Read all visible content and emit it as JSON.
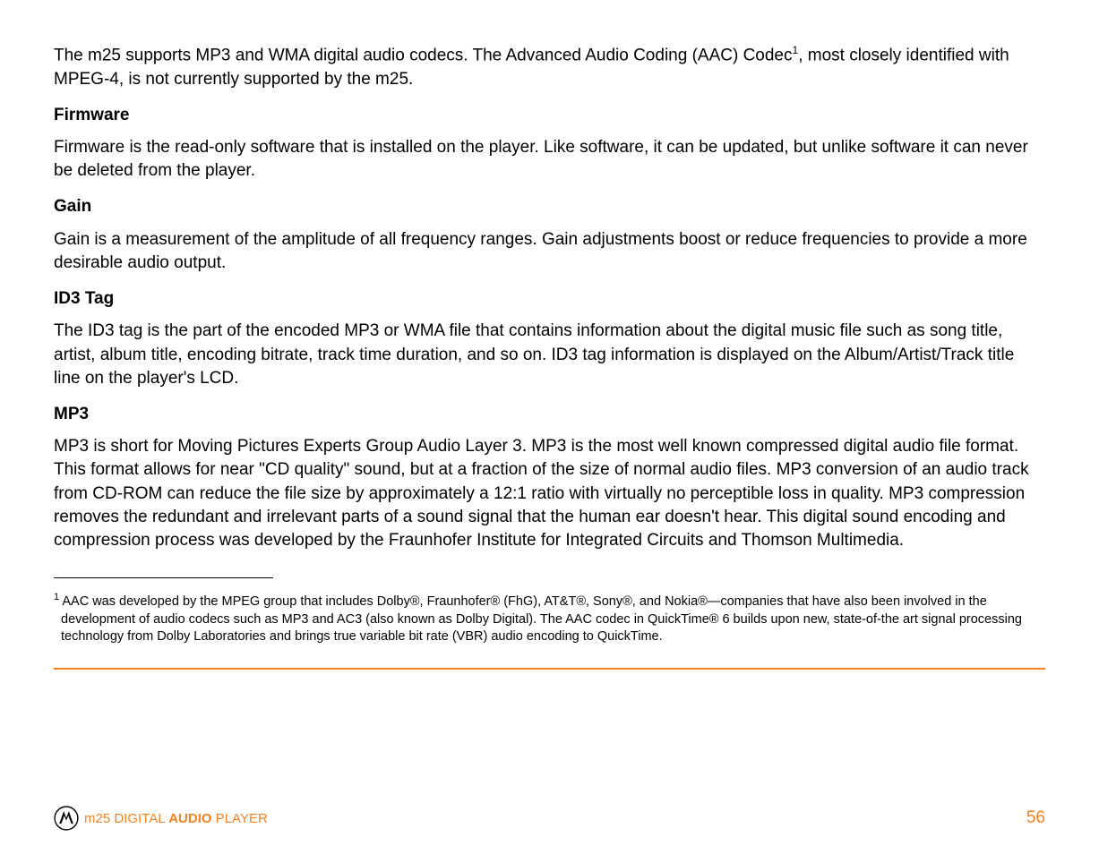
{
  "para_intro": "The m25 supports MP3 and WMA digital audio codecs. The Advanced Audio Coding (AAC) Codec",
  "para_intro_after": ", most closely identified with MPEG-4, is not currently supported by the m25.",
  "sup1": "1",
  "firmware_h": "Firmware",
  "firmware_p": "Firmware is the read-only software that is installed on the player. Like software, it can be updated, but unlike software it can never be deleted from the player.",
  "gain_h": "Gain",
  "gain_p": "Gain is a measurement of the amplitude of all frequency ranges. Gain adjustments boost or reduce frequencies to provide a more desirable audio output.",
  "id3_h": "ID3 Tag",
  "id3_p": "The ID3 tag is the part of the encoded MP3 or WMA file that contains information about the digital music file such as song title, artist, album title, encoding bitrate, track time duration, and so on. ID3 tag information is displayed on the Album/Artist/Track title line on the player's LCD.",
  "mp3_h": "MP3",
  "mp3_p": "MP3 is short for Moving Pictures Experts Group Audio Layer 3. MP3 is the most well known compressed digital audio file format. This format allows for near \"CD quality\" sound, but at a fraction of the size of normal audio files. MP3 conversion of an audio track from CD-ROM can reduce the file size by approximately a 12:1 ratio with virtually no perceptible loss in quality. MP3 compression removes the redundant and irrelevant parts of a sound signal that the human ear doesn't hear. This digital sound encoding and compression process was developed by the Fraunhofer Institute for Integrated Circuits and Thomson Multimedia.",
  "footnote_marker": "1",
  "footnote_text": " AAC was developed by the MPEG group that includes Dolby®, Fraunhofer® (FhG), AT&T®, Sony®, and Nokia®—companies that have also been involved in the development of audio codecs such as MP3 and AC3 (also known as Dolby Digital). The AAC codec in QuickTime® 6 builds upon new, state-of-the art signal processing technology from Dolby Laboratories and brings true variable bit rate (VBR) audio encoding to QuickTime.",
  "footer_prefix": "m25 DIGITAL ",
  "footer_audio": "AUDIO",
  "footer_suffix": " PLAYER",
  "page_num": "56"
}
